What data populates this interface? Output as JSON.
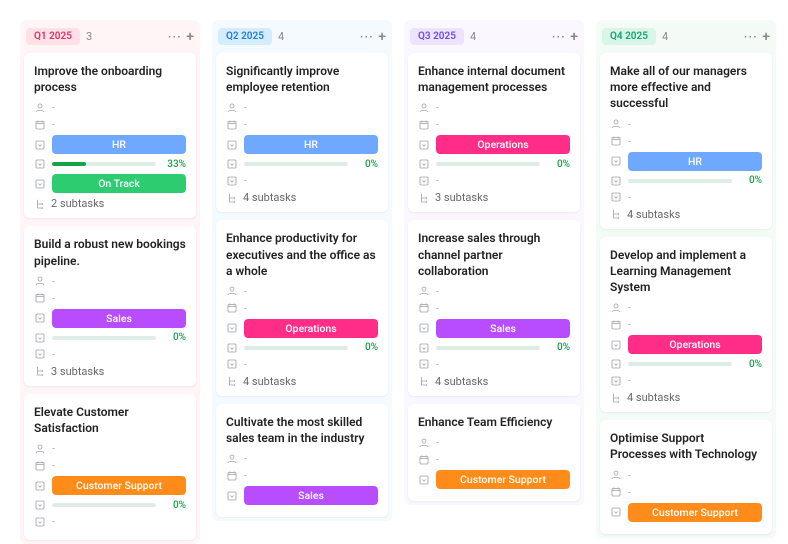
{
  "columns": [
    {
      "id": "q1",
      "label": "Q1 2025",
      "count": "3",
      "pillClass": "pill-q1",
      "bgClass": "col-bg-q1"
    },
    {
      "id": "q2",
      "label": "Q2 2025",
      "count": "4",
      "pillClass": "pill-q2",
      "bgClass": "col-bg-q2"
    },
    {
      "id": "q3",
      "label": "Q3 2025",
      "count": "4",
      "pillClass": "pill-q3",
      "bgClass": "col-bg-q3"
    },
    {
      "id": "q4",
      "label": "Q4 2025",
      "count": "4",
      "pillClass": "pill-q4",
      "bgClass": "col-bg-q4"
    }
  ],
  "cards": {
    "q1": [
      {
        "title": "Improve the onboarding process",
        "tag": "HR",
        "tagClass": "tag-hr",
        "progress": 33,
        "status": "On Track",
        "subtasks": "2 subtasks"
      },
      {
        "title": "Build a robust new bookings pipeline.",
        "tag": "Sales",
        "tagClass": "tag-sales",
        "progress": 0,
        "subtasks": "3 subtasks"
      },
      {
        "title": "Elevate Customer Satisfaction",
        "tag": "Customer Support",
        "tagClass": "tag-cs",
        "progress": 0
      }
    ],
    "q2": [
      {
        "title": "Significantly improve employee retention",
        "tag": "HR",
        "tagClass": "tag-hr",
        "progress": 0,
        "subtasks": "4 subtasks"
      },
      {
        "title": "Enhance productivity for executives and the office as a whole",
        "tag": "Operations",
        "tagClass": "tag-ops",
        "progress": 0,
        "subtasks": "4 subtasks"
      },
      {
        "title": "Cultivate the most skilled sales team in the industry",
        "tag": "Sales",
        "tagClass": "tag-sales"
      }
    ],
    "q3": [
      {
        "title": "Enhance internal document management processes",
        "tag": "Operations",
        "tagClass": "tag-ops",
        "progress": 0,
        "subtasks": "3 subtasks"
      },
      {
        "title": "Increase sales through channel partner collaboration",
        "tag": "Sales",
        "tagClass": "tag-sales",
        "progress": 0,
        "subtasks": "4 subtasks"
      },
      {
        "title": "Enhance Team Efficiency",
        "tag": "Customer Support",
        "tagClass": "tag-cs"
      }
    ],
    "q4": [
      {
        "title": "Make all of our managers more effective and successful",
        "tag": "HR",
        "tagClass": "tag-hr",
        "progress": 0,
        "subtasks": "4 subtasks"
      },
      {
        "title": "Develop and implement a Learning Management System",
        "tag": "Operations",
        "tagClass": "tag-ops",
        "progress": 0,
        "subtasks": "4 subtasks"
      },
      {
        "title": "Optimise Support Processes with Technology",
        "tag": "Customer Support",
        "tagClass": "tag-cs"
      }
    ]
  },
  "icons": {
    "person": "person-icon",
    "calendar": "calendar-icon",
    "dropdown": "dropdown-icon",
    "subtask": "subtask-icon"
  }
}
